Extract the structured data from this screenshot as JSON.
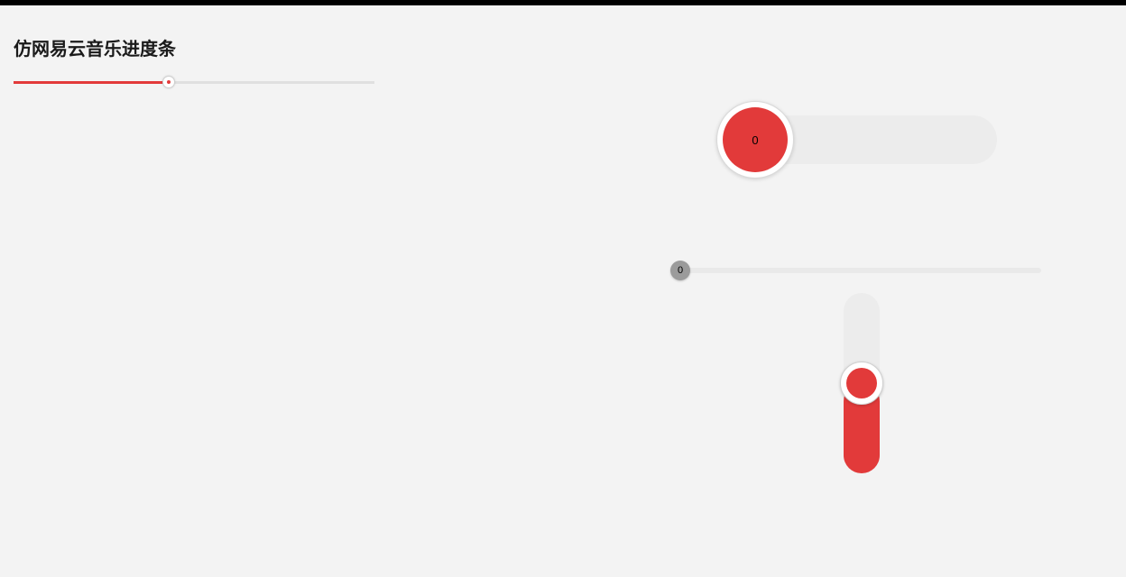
{
  "title": "仿网易云音乐进度条",
  "slider1": {
    "value": 43,
    "min": 0,
    "max": 100
  },
  "slider2": {
    "value": 0,
    "min": 0,
    "max": 100,
    "display": "0"
  },
  "slider3": {
    "value": 0,
    "min": 0,
    "max": 100,
    "display": "0"
  },
  "slider4": {
    "value": 50,
    "min": 0,
    "max": 100
  },
  "colors": {
    "accent": "#e23a3a",
    "track": "#ececec",
    "gray": "#9b9b9b"
  }
}
